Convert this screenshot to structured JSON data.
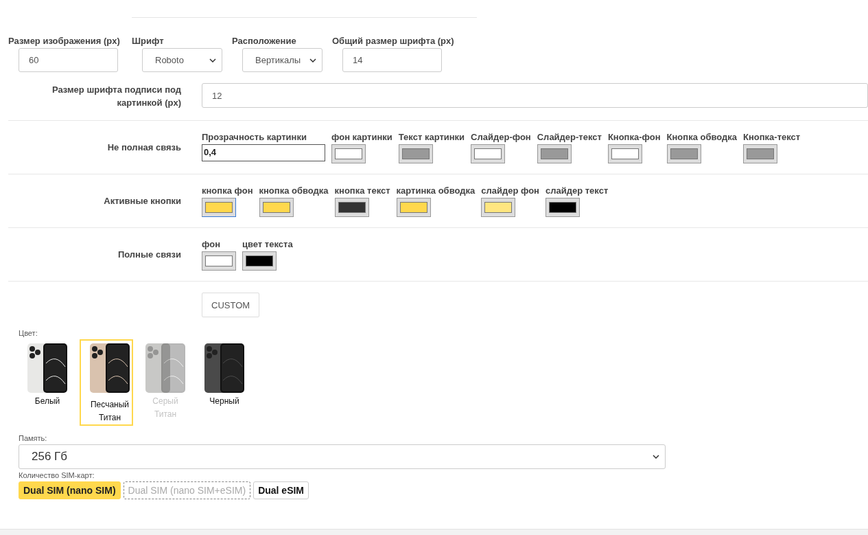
{
  "top_fields": [
    {
      "label": "Размер изображения (px)",
      "kind": "input",
      "value": "60"
    },
    {
      "label": "Шрифт",
      "kind": "select",
      "value": "Roboto"
    },
    {
      "label": "Расположение",
      "kind": "select",
      "value": "Вертикалы"
    },
    {
      "label": "Общий размер шрифта (px)",
      "kind": "input",
      "value": "14"
    }
  ],
  "caption_font": {
    "label": "Размер шрифта подписи под картинкой (px)",
    "value": "12"
  },
  "partial_link": {
    "label": "Не полная связь",
    "opacity": {
      "label": "Прозрачность картинки",
      "value": "0,4"
    },
    "swatches": [
      {
        "label": "фон картинки",
        "color": "#ffffff"
      },
      {
        "label": "Текст картинки",
        "color": "#999999"
      },
      {
        "label": "Слайдер-фон",
        "color": "#ffffff"
      },
      {
        "label": "Слайдер-текст",
        "color": "#999999"
      },
      {
        "label": "Кнопка-фон",
        "color": "#ffffff"
      },
      {
        "label": "Кнопка обводка",
        "color": "#999999"
      },
      {
        "label": "Кнопка-текст",
        "color": "#999999"
      }
    ]
  },
  "active_buttons": {
    "label": "Активные кнопки",
    "swatches": [
      {
        "label": "кнопка фон",
        "color": "#ffd84d",
        "focused": true
      },
      {
        "label": "кнопка обводка",
        "color": "#ffd84d",
        "focused": false
      },
      {
        "label": "кнопка текст",
        "color": "#333333",
        "focused": false
      },
      {
        "label": "картинка обводка",
        "color": "#ffd84d",
        "focused": false
      },
      {
        "label": "слайдер фон",
        "color": "#ffe680",
        "focused": false
      },
      {
        "label": "слайдер текст",
        "color": "#000000",
        "focused": false
      }
    ]
  },
  "full_links": {
    "label": "Полные связи",
    "swatches": [
      {
        "label": "фон",
        "color": "#ffffff"
      },
      {
        "label": "цвет текста",
        "color": "#000000"
      }
    ]
  },
  "custom_button": "CUSTOM",
  "color_picker": {
    "label": "Цвет:",
    "options": [
      {
        "name": "Белый",
        "color": "#e8e8e6",
        "selected": false,
        "disabled": false
      },
      {
        "name": "Песчаный Титан",
        "color": "#d9c2ae",
        "selected": true,
        "disabled": false
      },
      {
        "name": "Серый Титан",
        "color": "#c8c8c6",
        "selected": false,
        "disabled": true
      },
      {
        "name": "Черный",
        "color": "#4a4a4a",
        "selected": false,
        "disabled": false
      }
    ]
  },
  "memory": {
    "label": "Память:",
    "value": "256 Гб"
  },
  "sim": {
    "label": "Количество SIM-карт:",
    "options": [
      {
        "name": "Dual SIM (nano SIM)",
        "selected": true,
        "disabled": false
      },
      {
        "name": "Dual SIM (nano SIM+eSIM)",
        "selected": false,
        "disabled": true
      },
      {
        "name": "Dual eSIM",
        "selected": false,
        "disabled": false
      }
    ]
  }
}
